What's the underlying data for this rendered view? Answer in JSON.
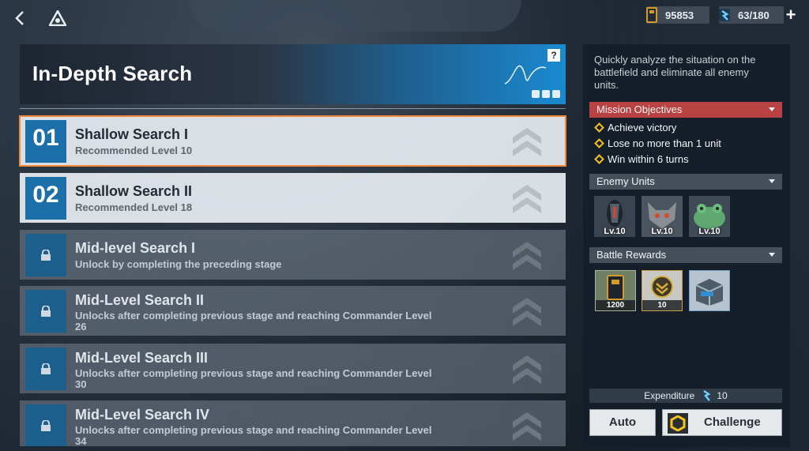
{
  "topbar": {
    "back_icon": "chevron-left-icon",
    "home_icon": "base-triangle-icon",
    "currency1": {
      "icon": "supply-card-icon",
      "value": "95853"
    },
    "currency2": {
      "icon": "energy-crystal-icon",
      "value": "63/180"
    },
    "plus_label": "+"
  },
  "header": {
    "title": "In-Depth Search",
    "help_label": "?"
  },
  "stages": [
    {
      "number": "01",
      "name": "Shallow Search I",
      "desc": "Recommended Level 10",
      "state": "selected"
    },
    {
      "number": "02",
      "name": "Shallow Search II",
      "desc": "Recommended Level 18",
      "state": "unlocked"
    },
    {
      "number": "",
      "name": "Mid-level Search I",
      "desc": "Unlock by completing the preceding stage",
      "state": "locked"
    },
    {
      "number": "",
      "name": "Mid-Level Search II",
      "desc": "Unlocks after completing previous stage and reaching Commander Level 26",
      "state": "locked"
    },
    {
      "number": "",
      "name": "Mid-Level Search III",
      "desc": "Unlocks after completing previous stage and reaching Commander Level 30",
      "state": "locked"
    },
    {
      "number": "",
      "name": "Mid-Level Search IV",
      "desc": "Unlocks after completing previous stage and reaching Commander Level 34",
      "state": "locked"
    }
  ],
  "panel": {
    "intro": "Quickly analyze the situation on the battlefield and eliminate all enemy units.",
    "objectives_title": "Mission Objectives",
    "objectives": [
      "Achieve victory",
      "Lose no more than 1 unit",
      "Win within 6 turns"
    ],
    "enemies_title": "Enemy Units",
    "enemies": [
      {
        "name": "armored-pod-enemy",
        "level": "Lv.10"
      },
      {
        "name": "beast-enemy",
        "level": "Lv.10"
      },
      {
        "name": "frog-creature-enemy",
        "level": "Lv.10"
      }
    ],
    "rewards_title": "Battle Rewards",
    "rewards": [
      {
        "name": "supply-card-reward",
        "count": "1200"
      },
      {
        "name": "rank-medal-reward",
        "count": "10"
      },
      {
        "name": "supply-crate-reward",
        "count": ""
      }
    ],
    "expenditure_label": "Expenditure",
    "expenditure_value": "10",
    "auto_label": "Auto",
    "challenge_label": "Challenge"
  },
  "colors": {
    "accent_blue": "#1c6fa8",
    "selected_outline": "#f08a3a",
    "objective_red": "#b94242",
    "objective_icon": "#f4c21b"
  }
}
